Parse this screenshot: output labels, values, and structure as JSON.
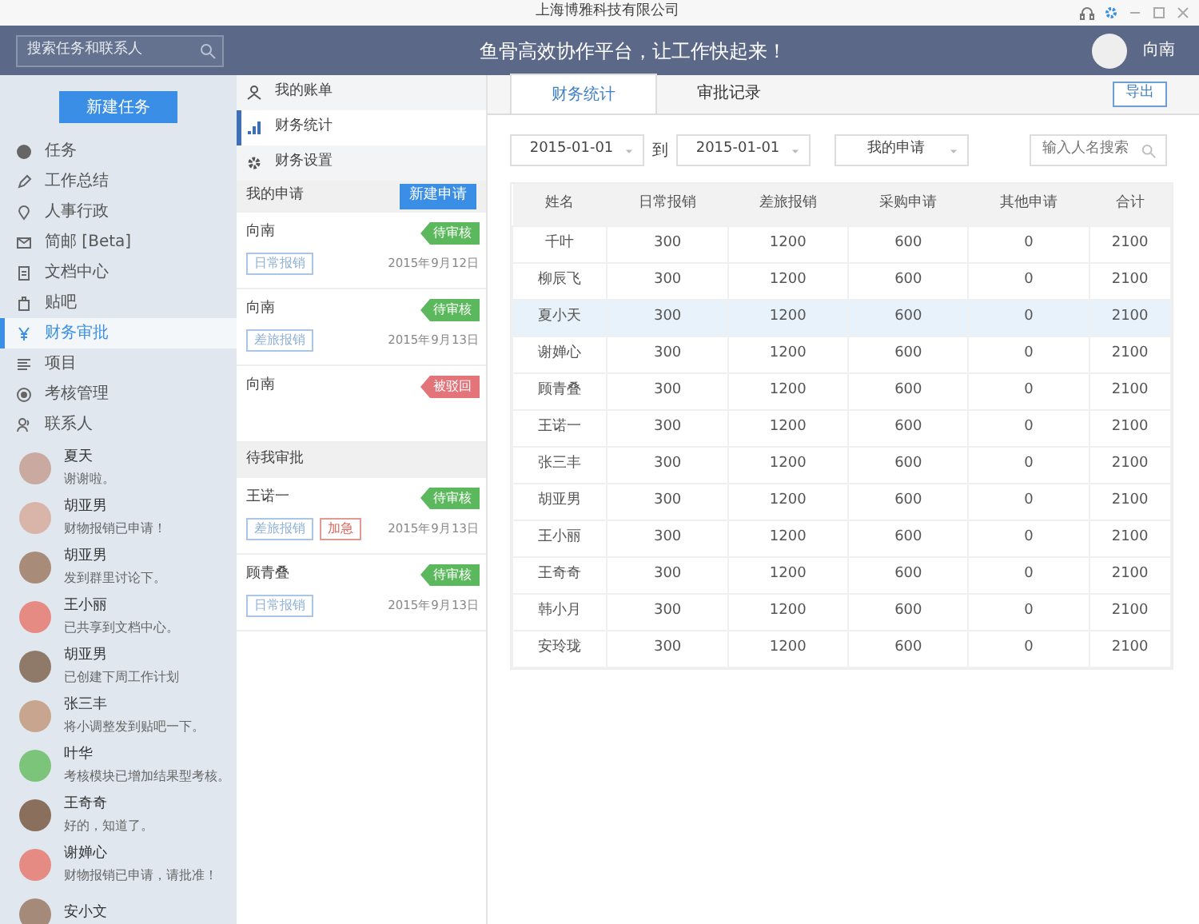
{
  "window": {
    "title": "上海博雅科技有限公司"
  },
  "header": {
    "search_placeholder": "搜索任务和联系人",
    "slogan": "鱼骨高效协作平台，让工作快起来！",
    "user": "向南"
  },
  "sidebar": {
    "new_button": "新建任务",
    "items": [
      {
        "label": "任务",
        "selected": false
      },
      {
        "label": "工作总结",
        "selected": false
      },
      {
        "label": "人事行政",
        "selected": false
      },
      {
        "label": "简邮 [Beta]",
        "selected": false
      },
      {
        "label": "文档中心",
        "selected": false
      },
      {
        "label": "贴吧",
        "selected": false
      },
      {
        "label": "财务审批",
        "selected": true
      },
      {
        "label": "项目",
        "selected": false
      },
      {
        "label": "考核管理",
        "selected": false
      },
      {
        "label": "联系人",
        "selected": false
      }
    ],
    "contacts": [
      {
        "name": "夏天",
        "message": "谢谢啦。"
      },
      {
        "name": "胡亚男",
        "message": "财物报销已申请！"
      },
      {
        "name": "胡亚男",
        "message": "发到群里讨论下。"
      },
      {
        "name": "王小丽",
        "message": "已共享到文档中心。"
      },
      {
        "name": "胡亚男",
        "message": "已创建下周工作计划"
      },
      {
        "name": "张三丰",
        "message": "将小调整发到贴吧一下。"
      },
      {
        "name": "叶华",
        "message": "考核模块已增加结果型考核。"
      },
      {
        "name": "王奇奇",
        "message": "好的，知道了。"
      },
      {
        "name": "谢婵心",
        "message": "财物报销已申请，请批准！"
      },
      {
        "name": "安小文"
      }
    ]
  },
  "subnav": {
    "items": [
      {
        "label": "我的账单",
        "selected": false
      },
      {
        "label": "财务统计",
        "selected": true
      },
      {
        "label": "财务设置",
        "selected": false
      }
    ],
    "section": "我的申请",
    "new_button": "新建申请",
    "requests": [
      {
        "kind": "request",
        "name": "向南",
        "status": "待审核",
        "color": "#5cb85c",
        "tags": [
          {
            "label": "日常报销",
            "kind": "info"
          }
        ],
        "date": "2015年9月12日"
      },
      {
        "kind": "request",
        "name": "向南",
        "status": "待审核",
        "color": "#5cb85c",
        "tags": [
          {
            "label": "差旅报销",
            "kind": "info"
          }
        ],
        "date": "2015年9月13日"
      },
      {
        "kind": "request",
        "name": "向南",
        "status": "被驳回",
        "color": "#e2747a"
      },
      {
        "kind": "section",
        "label": "待我审批"
      },
      {
        "kind": "request",
        "name": "王诺一",
        "status": "待审核",
        "color": "#5cb85c",
        "tags": [
          {
            "label": "差旅报销",
            "kind": "info"
          },
          {
            "label": "加急",
            "kind": "urgent"
          }
        ],
        "date": "2015年9月13日"
      },
      {
        "kind": "request",
        "name": "顾青叠",
        "status": "待审核",
        "color": "#5cb85c",
        "tags": [
          {
            "label": "日常报销",
            "kind": "info"
          }
        ],
        "date": "2015年9月13日"
      }
    ]
  },
  "main": {
    "tabs": [
      {
        "label": "财务统计",
        "selected": true
      },
      {
        "label": "审批记录",
        "selected": false
      }
    ],
    "export_button": "导出",
    "filters": {
      "from": "2015-01-01",
      "to_label": "到",
      "to": "2015-01-01",
      "scope": "我的申请",
      "search_placeholder": "输入人名搜索"
    },
    "table": {
      "columns": [
        "姓名",
        "日常报销",
        "差旅报销",
        "采购申请",
        "其他申请",
        "合计"
      ],
      "rows": [
        {
          "cells": [
            "千叶",
            "300",
            "1200",
            "600",
            "0",
            "2100"
          ],
          "selected": false
        },
        {
          "cells": [
            "柳辰飞",
            "300",
            "1200",
            "600",
            "0",
            "2100"
          ],
          "selected": false
        },
        {
          "cells": [
            "夏小天",
            "300",
            "1200",
            "600",
            "0",
            "2100"
          ],
          "selected": true
        },
        {
          "cells": [
            "谢婵心",
            "300",
            "1200",
            "600",
            "0",
            "2100"
          ],
          "selected": false
        },
        {
          "cells": [
            "顾青叠",
            "300",
            "1200",
            "600",
            "0",
            "2100"
          ],
          "selected": false
        },
        {
          "cells": [
            "王诺一",
            "300",
            "1200",
            "600",
            "0",
            "2100"
          ],
          "selected": false
        },
        {
          "cells": [
            "张三丰",
            "300",
            "1200",
            "600",
            "0",
            "2100"
          ],
          "selected": false
        },
        {
          "cells": [
            "胡亚男",
            "300",
            "1200",
            "600",
            "0",
            "2100"
          ],
          "selected": false
        },
        {
          "cells": [
            "王小丽",
            "300",
            "1200",
            "600",
            "0",
            "2100"
          ],
          "selected": false
        },
        {
          "cells": [
            "王奇奇",
            "300",
            "1200",
            "600",
            "0",
            "2100"
          ],
          "selected": false
        },
        {
          "cells": [
            "韩小月",
            "300",
            "1200",
            "600",
            "0",
            "2100"
          ],
          "selected": false
        },
        {
          "cells": [
            "安玲珑",
            "300",
            "1200",
            "600",
            "0",
            "2100"
          ],
          "selected": false
        }
      ]
    }
  }
}
